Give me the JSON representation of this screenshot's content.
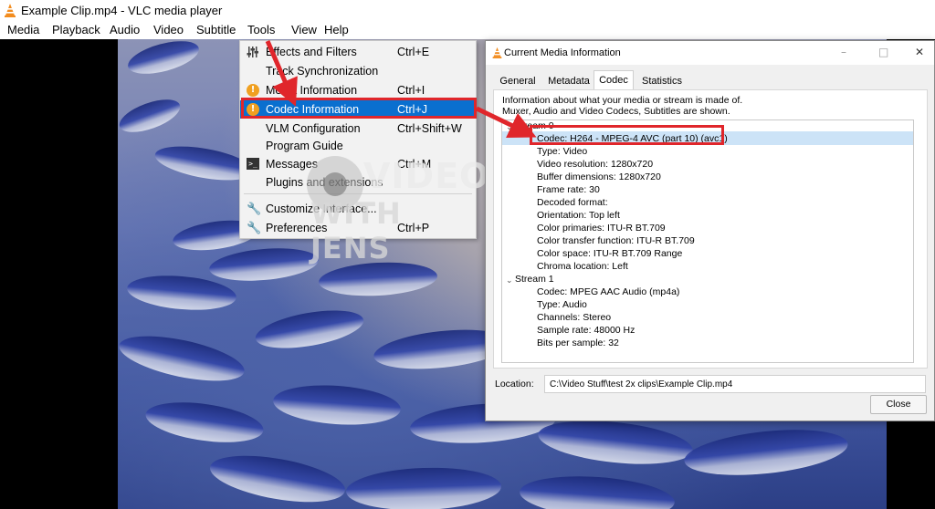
{
  "window": {
    "title": "Example Clip.mp4 - VLC media player",
    "icon": "vlc-cone-icon"
  },
  "menubar": {
    "items": [
      "Media",
      "Playback",
      "Audio",
      "Video",
      "Subtitle",
      "Tools",
      "View",
      "Help"
    ]
  },
  "tools_menu": {
    "items": [
      {
        "label": "Effects and Filters",
        "shortcut": "Ctrl+E",
        "icon": "sliders-icon"
      },
      {
        "label": "Track Synchronization",
        "shortcut": "",
        "icon": ""
      },
      {
        "label": "Media Information",
        "shortcut": "Ctrl+I",
        "icon": "info-icon"
      },
      {
        "label": "Codec Information",
        "shortcut": "Ctrl+J",
        "icon": "info-icon",
        "selected": true
      },
      {
        "label": "VLM Configuration",
        "shortcut": "Ctrl+Shift+W",
        "icon": ""
      },
      {
        "label": "Program Guide",
        "shortcut": "",
        "icon": ""
      },
      {
        "label": "Messages",
        "shortcut": "Ctrl+M",
        "icon": "terminal-icon"
      },
      {
        "label": "Plugins and extensions",
        "shortcut": "",
        "icon": ""
      },
      {
        "label": "Customize Interface...",
        "shortcut": "",
        "icon": "wrench-icon"
      },
      {
        "label": "Preferences",
        "shortcut": "Ctrl+P",
        "icon": "wrench-icon"
      }
    ]
  },
  "watermark": {
    "line1": "VIDEO",
    "line2": "WITH JENS"
  },
  "dialog": {
    "title": "Current Media Information",
    "controls": [
      "–",
      "□",
      "✕"
    ],
    "tabs": [
      "General",
      "Metadata",
      "Codec",
      "Statistics"
    ],
    "active_tab": "Codec",
    "description_line1": "Information about what your media or stream is made of.",
    "description_line2": "Muxer, Audio and Video Codecs, Subtitles are shown.",
    "streams": [
      {
        "name": "Stream 0",
        "lines": [
          "Codec: H264 - MPEG-4 AVC (part 10) (avc1)",
          "Type: Video",
          "Video resolution: 1280x720",
          "Buffer dimensions: 1280x720",
          "Frame rate: 30",
          "Decoded format:",
          "Orientation: Top left",
          "Color primaries: ITU-R BT.709",
          "Color transfer function: ITU-R BT.709",
          "Color space: ITU-R BT.709 Range",
          "Chroma location: Left"
        ]
      },
      {
        "name": "Stream 1",
        "lines": [
          "Codec: MPEG AAC Audio (mp4a)",
          "Type: Audio",
          "Channels: Stereo",
          "Sample rate: 48000 Hz",
          "Bits per sample: 32"
        ]
      }
    ],
    "location_label": "Location:",
    "location_value": "C:\\Video Stuff\\test 2x clips\\Example Clip.mp4",
    "close_label": "Close"
  },
  "colors": {
    "highlight_box": "#e0262b",
    "menu_selected": "#0a6fcf",
    "tree_selected": "#cce3f7"
  }
}
